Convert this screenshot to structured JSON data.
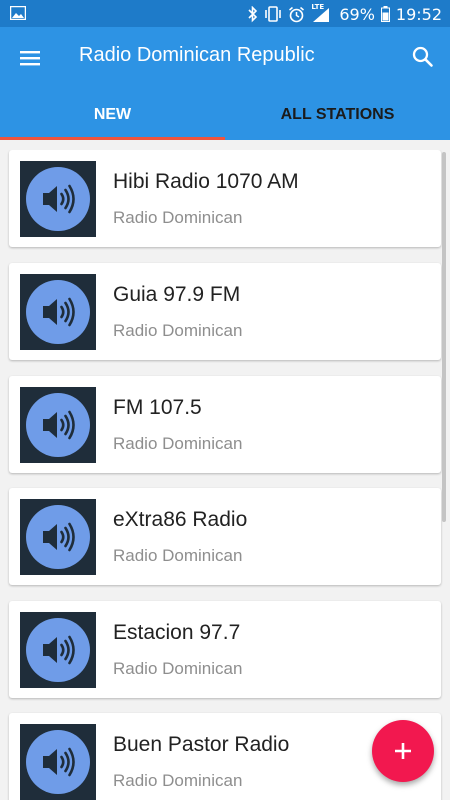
{
  "status_bar": {
    "lte_label": "LTE",
    "battery": "69%",
    "time": "19:52",
    "icons": [
      "image-icon",
      "bluetooth-icon",
      "vibrate-icon",
      "alarm-icon",
      "signal-icon",
      "battery-icon"
    ]
  },
  "app_bar": {
    "title": "Radio Dominican Republic",
    "background": "#2d93e4",
    "icons": [
      "menu-icon",
      "search-icon"
    ]
  },
  "tabs": [
    {
      "label": "NEW",
      "selected": true
    },
    {
      "label": "ALL STATIONS",
      "selected": false
    }
  ],
  "accent_color": "#f0543c",
  "fab_color": "#f2184f",
  "stations": [
    {
      "name": "Hibi Radio 1070 AM",
      "subtitle": "Radio Dominican",
      "icon": "speaker-icon"
    },
    {
      "name": "Guia 97.9 FM",
      "subtitle": "Radio Dominican",
      "icon": "speaker-icon"
    },
    {
      "name": "FM 107.5",
      "subtitle": "Radio Dominican",
      "icon": "speaker-icon"
    },
    {
      "name": "eXtra86 Radio",
      "subtitle": "Radio Dominican",
      "icon": "speaker-icon"
    },
    {
      "name": "Estacion 97.7",
      "subtitle": "Radio Dominican",
      "icon": "speaker-icon"
    },
    {
      "name": "Buen Pastor Radio",
      "subtitle": "Radio Dominican",
      "icon": "speaker-icon"
    }
  ],
  "fab": {
    "icon": "plus-icon"
  }
}
